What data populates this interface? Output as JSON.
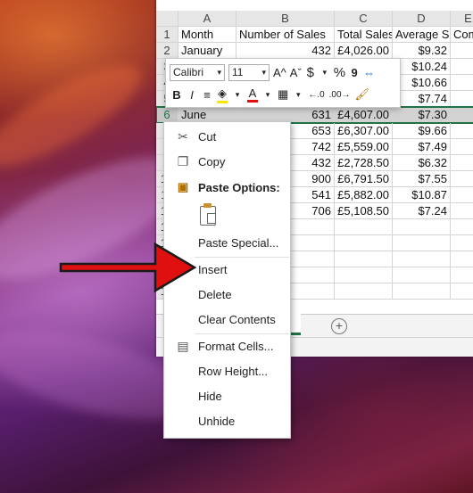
{
  "spreadsheet": {
    "columns": [
      "A",
      "B",
      "C",
      "D",
      "E"
    ],
    "rows": [
      {
        "num": "1",
        "cells": [
          "Month",
          "Number of Sales",
          "Total Sales",
          "Average S",
          "Com"
        ]
      },
      {
        "num": "2",
        "cells": [
          "January",
          "432",
          "£4,026.00",
          "$9.32",
          ""
        ]
      },
      {
        "num": "3",
        "cells": [
          "",
          "",
          "",
          "$10.24",
          ""
        ]
      },
      {
        "num": "4",
        "cells": [
          "",
          "",
          "",
          "$10.66",
          ""
        ]
      },
      {
        "num": "5",
        "cells": [
          "",
          "",
          "",
          "$7.74",
          ""
        ]
      },
      {
        "num": "6",
        "cells": [
          "June",
          "631",
          "£4,607.00",
          "$7.30",
          ""
        ]
      },
      {
        "num": "7",
        "cells": [
          "",
          "653",
          "£6,307.00",
          "$9.66",
          ""
        ]
      },
      {
        "num": "8",
        "cells": [
          "",
          "742",
          "£5,559.00",
          "$7.49",
          ""
        ]
      },
      {
        "num": "9",
        "cells": [
          "",
          "432",
          "£2,728.50",
          "$6.32",
          ""
        ]
      },
      {
        "num": "10",
        "cells": [
          "",
          "900",
          "£6,791.50",
          "$7.55",
          ""
        ]
      },
      {
        "num": "11",
        "cells": [
          "",
          "541",
          "£5,882.00",
          "$10.87",
          ""
        ]
      },
      {
        "num": "12",
        "cells": [
          "",
          "706",
          "£5,108.50",
          "$7.24",
          ""
        ]
      },
      {
        "num": "13",
        "cells": [
          "",
          "",
          "",
          "",
          ""
        ]
      },
      {
        "num": "14",
        "cells": [
          "",
          "",
          "",
          "",
          ""
        ]
      },
      {
        "num": "15",
        "cells": [
          "",
          "",
          "",
          "",
          ""
        ]
      },
      {
        "num": "16",
        "cells": [
          "",
          "",
          "",
          "",
          ""
        ]
      },
      {
        "num": "17",
        "cells": [
          "",
          "",
          "",
          "",
          ""
        ]
      }
    ],
    "selected_row": "6",
    "add_sheet_label": "+"
  },
  "mini_toolbar": {
    "font_name": "Calibri",
    "font_size": "11",
    "grow_font": "A^",
    "shrink_font": "Aˇ",
    "currency": "$",
    "percent": "%",
    "comma": "9",
    "bold": "B",
    "italic": "I",
    "increase_decimal": "←.0",
    "decrease_decimal": ".00→"
  },
  "context_menu": {
    "items": [
      {
        "label": "Cut",
        "icon": "scissors-icon",
        "glyph": "✂"
      },
      {
        "label": "Copy",
        "icon": "copy-icon",
        "glyph": "❐"
      },
      {
        "label": "Paste Options:",
        "icon": "paste-icon",
        "glyph": "📋"
      },
      {
        "label": "Paste Special...",
        "icon": "",
        "glyph": ""
      },
      {
        "label": "Insert",
        "icon": "",
        "glyph": ""
      },
      {
        "label": "Delete",
        "icon": "",
        "glyph": ""
      },
      {
        "label": "Clear Contents",
        "icon": "",
        "glyph": ""
      },
      {
        "label": "Format Cells...",
        "icon": "format-cells-icon",
        "glyph": "▤"
      },
      {
        "label": "Row Height...",
        "icon": "",
        "glyph": ""
      },
      {
        "label": "Hide",
        "icon": "",
        "glyph": ""
      },
      {
        "label": "Unhide",
        "icon": "",
        "glyph": ""
      }
    ]
  },
  "colors": {
    "excel_green": "#217346",
    "arrow_red": "#e01010",
    "selection_gray": "#d2d2d2"
  }
}
